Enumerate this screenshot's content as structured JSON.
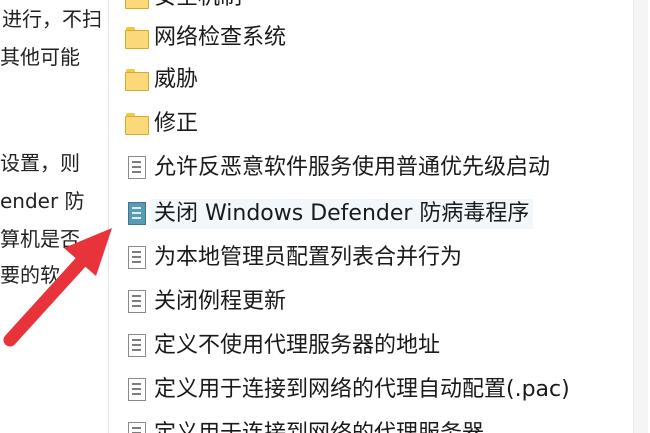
{
  "description_pane": {
    "lines": [
      "进行，不扫",
      "其他可能",
      "设置，则",
      "ender 防",
      "算机是否",
      "要的软"
    ]
  },
  "list": {
    "items": [
      {
        "label": "安全机制",
        "type": "folder"
      },
      {
        "label": "网络检查系统",
        "type": "folder"
      },
      {
        "label": "威胁",
        "type": "folder"
      },
      {
        "label": "修正",
        "type": "folder"
      },
      {
        "label": "允许反恶意软件服务使用普通优先级启动",
        "type": "setting"
      },
      {
        "label": "关闭 Windows Defender 防病毒程序",
        "type": "setting",
        "selected": true
      },
      {
        "label": "为本地管理员配置列表合并行为",
        "type": "setting"
      },
      {
        "label": "关闭例程更新",
        "type": "setting"
      },
      {
        "label": "定义不使用代理服务器的地址",
        "type": "setting"
      },
      {
        "label": "定义用于连接到网络的代理自动配置(.pac)",
        "type": "setting"
      },
      {
        "label": "定义用于连接到网络的代理服务器",
        "type": "setting"
      }
    ]
  },
  "colors": {
    "folder": "#fbd97a",
    "arrow": "#e8333a",
    "selected_icon": "#5a9ab3"
  }
}
